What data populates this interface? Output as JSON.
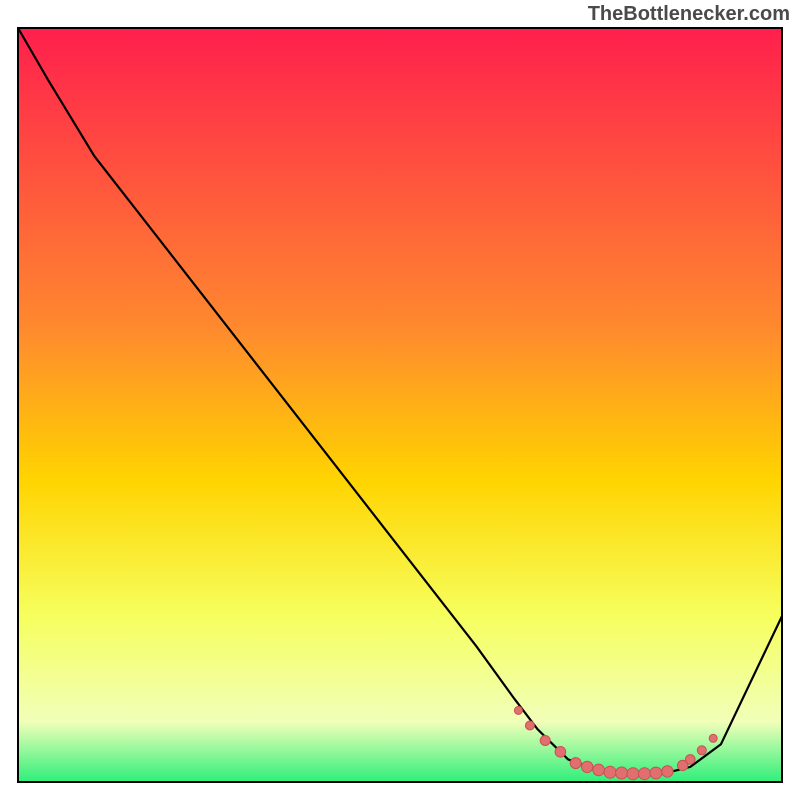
{
  "watermark": "TheBottlenecker.com",
  "colors": {
    "top": "#ff1f4d",
    "mid1": "#ff7a2e",
    "mid2": "#ffd400",
    "mid3": "#f6ff5e",
    "low": "#f1ffb9",
    "bottom": "#2eef7a",
    "curve": "#000000",
    "marker_fill": "#e26f6f",
    "marker_stroke": "#c85050",
    "frame": "#000000",
    "bg": "#ffffff"
  },
  "chart_data": {
    "type": "line",
    "title": "",
    "xlabel": "",
    "ylabel": "",
    "xlim": [
      0,
      100
    ],
    "ylim": [
      0,
      100
    ],
    "curve": {
      "x": [
        0,
        4,
        10,
        20,
        30,
        40,
        50,
        60,
        65,
        68,
        72,
        76,
        80,
        84,
        88,
        92,
        100
      ],
      "y": [
        100,
        93,
        83,
        70,
        57,
        44,
        31,
        18,
        11,
        7,
        3,
        1.5,
        1,
        1,
        2,
        5,
        22
      ]
    },
    "flat_markers": {
      "x": [
        65.5,
        67,
        69,
        71,
        73,
        74.5,
        76,
        77.5,
        79,
        80.5,
        82,
        83.5,
        85,
        87,
        88,
        89.5,
        91
      ],
      "y": [
        9.5,
        7.5,
        5.5,
        4,
        2.5,
        2,
        1.6,
        1.3,
        1.2,
        1.1,
        1.1,
        1.2,
        1.4,
        2.2,
        3,
        4.2,
        5.8
      ],
      "r": [
        4,
        4.5,
        5,
        5.3,
        5.5,
        5.7,
        5.8,
        6,
        6,
        6,
        6,
        5.9,
        5.7,
        5.2,
        4.8,
        4.5,
        4
      ]
    }
  }
}
